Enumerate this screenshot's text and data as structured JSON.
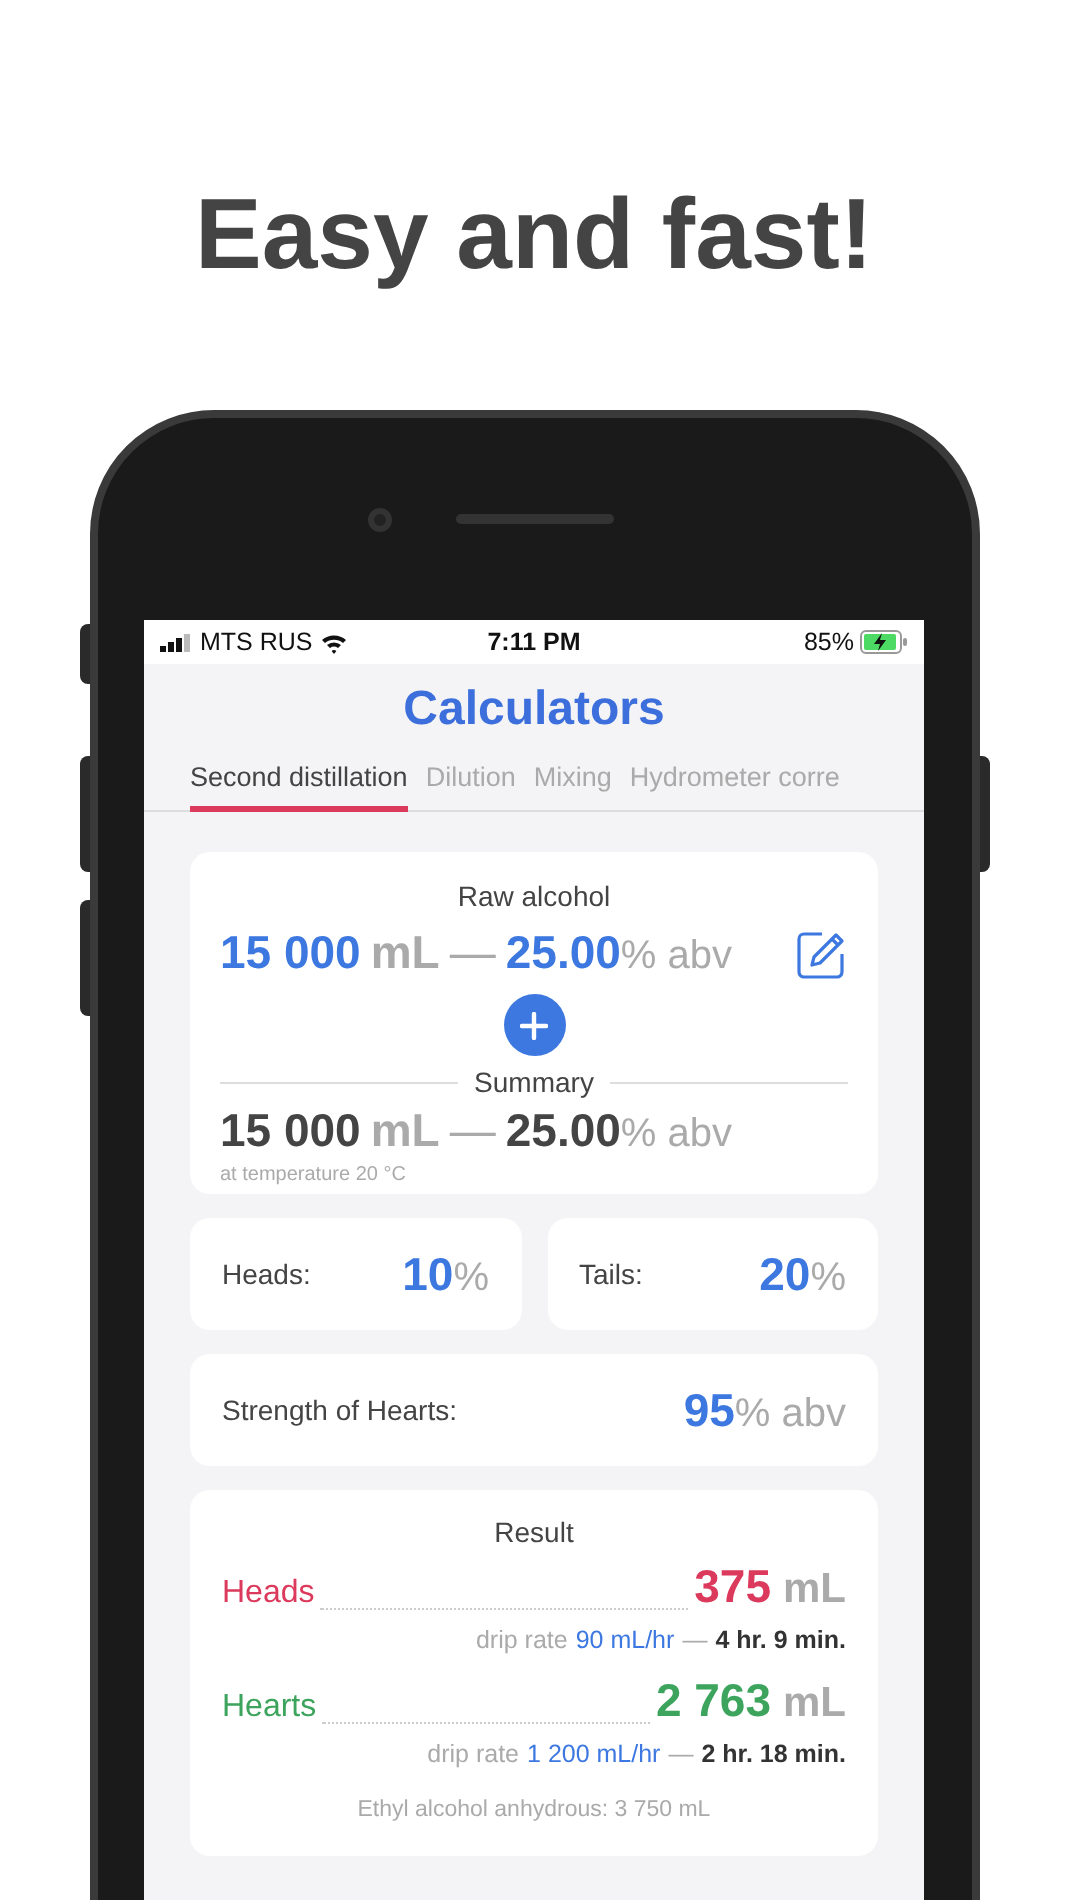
{
  "headline": "Easy and fast!",
  "status_bar": {
    "carrier": "MTS RUS",
    "time": "7:11 PM",
    "battery": "85%"
  },
  "title": "Calculators",
  "tabs": [
    {
      "label": "Second distillation",
      "selected": true
    },
    {
      "label": "Dilution",
      "selected": false
    },
    {
      "label": "Mixing",
      "selected": false
    },
    {
      "label": "Hydrometer corre",
      "selected": false
    }
  ],
  "raw_alcohol": {
    "title": "Raw alcohol",
    "volume": "15 000",
    "volume_unit": "mL",
    "dash": "—",
    "strength": "25.00",
    "strength_unit": "% abv"
  },
  "summary": {
    "title": "Summary",
    "volume": "15 000",
    "volume_unit": "mL",
    "dash": "—",
    "strength": "25.00",
    "strength_unit": "% abv",
    "note": "at temperature 20 °C"
  },
  "fractions": [
    {
      "label": "Heads:",
      "value": "10",
      "unit": "%"
    },
    {
      "label": "Tails:",
      "value": "20",
      "unit": "%"
    }
  ],
  "hearts_strength": {
    "label": "Strength of Hearts:",
    "value": "95",
    "unit": "% abv"
  },
  "result": {
    "title": "Result",
    "rows": [
      {
        "name": "Heads",
        "color": "#dc3a5c",
        "volume": "375",
        "unit": "mL",
        "rate_label": "drip rate",
        "rate": "90 mL/hr",
        "dash": "—",
        "duration": "4 hr. 9 min."
      },
      {
        "name": "Hearts",
        "color": "#3da45e",
        "volume": "2 763",
        "unit": "mL",
        "rate_label": "drip rate",
        "rate": "1 200 mL/hr",
        "dash": "—",
        "duration": "2 hr. 18 min."
      }
    ],
    "footnote": "Ethyl alcohol anhydrous: 3 750 mL"
  }
}
